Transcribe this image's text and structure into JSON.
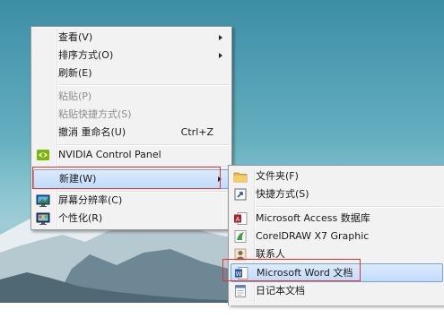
{
  "context_menu": {
    "items": [
      {
        "label": "查看(V)"
      },
      {
        "label": "排序方式(O)"
      },
      {
        "label": "刷新(E)"
      },
      {
        "label": "粘贴(P)"
      },
      {
        "label": "粘贴快捷方式(S)"
      },
      {
        "label": "撤消 重命名(U)",
        "shortcut": "Ctrl+Z"
      },
      {
        "label": "NVIDIA Control Panel",
        "icon": "nvidia-icon"
      },
      {
        "label": "新建(W)"
      },
      {
        "label": "屏幕分辨率(C)",
        "icon": "screen-resolution-icon"
      },
      {
        "label": "个性化(R)",
        "icon": "personalize-icon"
      }
    ]
  },
  "new_submenu": {
    "items": [
      {
        "label": "文件夹(F)",
        "icon": "folder-icon"
      },
      {
        "label": "快捷方式(S)",
        "icon": "shortcut-icon"
      },
      {
        "label": "Microsoft Access 数据库",
        "icon": "access-icon"
      },
      {
        "label": "CorelDRAW X7 Graphic",
        "icon": "coreldraw-icon"
      },
      {
        "label": "联系人",
        "icon": "contact-icon"
      },
      {
        "label": "Microsoft Word 文档",
        "icon": "word-icon"
      },
      {
        "label": "日记本文档",
        "icon": "journal-icon"
      }
    ]
  },
  "colors": {
    "highlight_border": "#e8332d",
    "hover_fill": "#c1dbfc"
  }
}
